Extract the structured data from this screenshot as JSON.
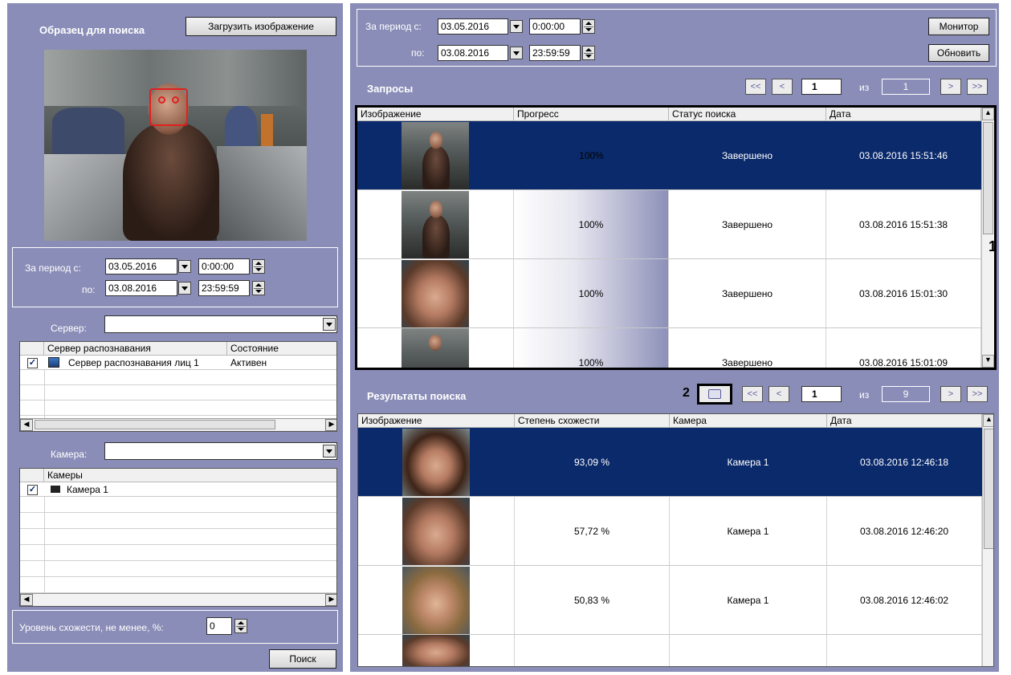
{
  "sample": {
    "title": "Образец для поиска",
    "load_button": "Загрузить изображение",
    "period_from_label": "За период с:",
    "period_to_label": "по:",
    "date_from": "03.05.2016",
    "time_from": "0:00:00",
    "date_to": "03.08.2016",
    "time_to": "23:59:59",
    "server_label": "Сервер:",
    "server_value": "",
    "servers_table": {
      "columns": [
        "Сервер распознавания",
        "Состояние"
      ],
      "rows": [
        {
          "name": "Сервер распознавания лиц 1",
          "state": "Активен",
          "checked": true
        }
      ]
    },
    "camera_label": "Камера:",
    "camera_value": "",
    "cameras_table": {
      "columns": [
        "Камеры"
      ],
      "rows": [
        {
          "name": "Камера 1",
          "checked": true
        }
      ]
    },
    "similarity_label": "Уровень схожести, не менее, %:",
    "similarity_value": "0",
    "search_button": "Поиск"
  },
  "top": {
    "period_from_label": "За период с:",
    "period_to_label": "по:",
    "date_from": "03.05.2016",
    "time_from": "0:00:00",
    "date_to": "03.08.2016",
    "time_to": "23:59:59",
    "monitor_button": "Монитор",
    "refresh_button": "Обновить"
  },
  "requests": {
    "title": "Запросы",
    "page": "1",
    "of_label": "из",
    "pages": "1",
    "nav": {
      "first": "<<",
      "prev": "<",
      "next": ">",
      "last": ">>"
    },
    "columns": [
      "Изображение",
      "Прогресс",
      "Статус поиска",
      "Дата"
    ],
    "rows": [
      {
        "progress": "100%",
        "progress_value": 1.0,
        "status": "Завершено",
        "date": "03.08.2016 15:51:46"
      },
      {
        "progress": "100%",
        "progress_value": 1.0,
        "status": "Завершено",
        "date": "03.08.2016 15:51:38"
      },
      {
        "progress": "100%",
        "progress_value": 1.0,
        "status": "Завершено",
        "date": "03.08.2016 15:01:30"
      },
      {
        "progress": "100%",
        "progress_value": 1.0,
        "status": "Завершено",
        "date": "03.08.2016 15:01:09"
      }
    ],
    "callout": "1"
  },
  "results": {
    "title": "Результаты поиска",
    "callout": "2",
    "page": "1",
    "of_label": "из",
    "pages": "9",
    "nav": {
      "first": "<<",
      "prev": "<",
      "next": ">",
      "last": ">>"
    },
    "columns": [
      "Изображение",
      "Степень схожести",
      "Камера",
      "Дата"
    ],
    "rows": [
      {
        "similarity": "93,09 %",
        "camera": "Камера 1",
        "date": "03.08.2016 12:46:18"
      },
      {
        "similarity": "57,72 %",
        "camera": "Камера 1",
        "date": "03.08.2016 12:46:20"
      },
      {
        "similarity": "50,83 %",
        "camera": "Камера 1",
        "date": "03.08.2016 12:46:02"
      }
    ]
  },
  "colors": {
    "panel": "#8a8db7",
    "selection": "#0b2a6b",
    "face_box": "#e02020"
  },
  "icons": {
    "print": "printer-icon",
    "server": "server-icon",
    "camera": "camera-icon"
  }
}
